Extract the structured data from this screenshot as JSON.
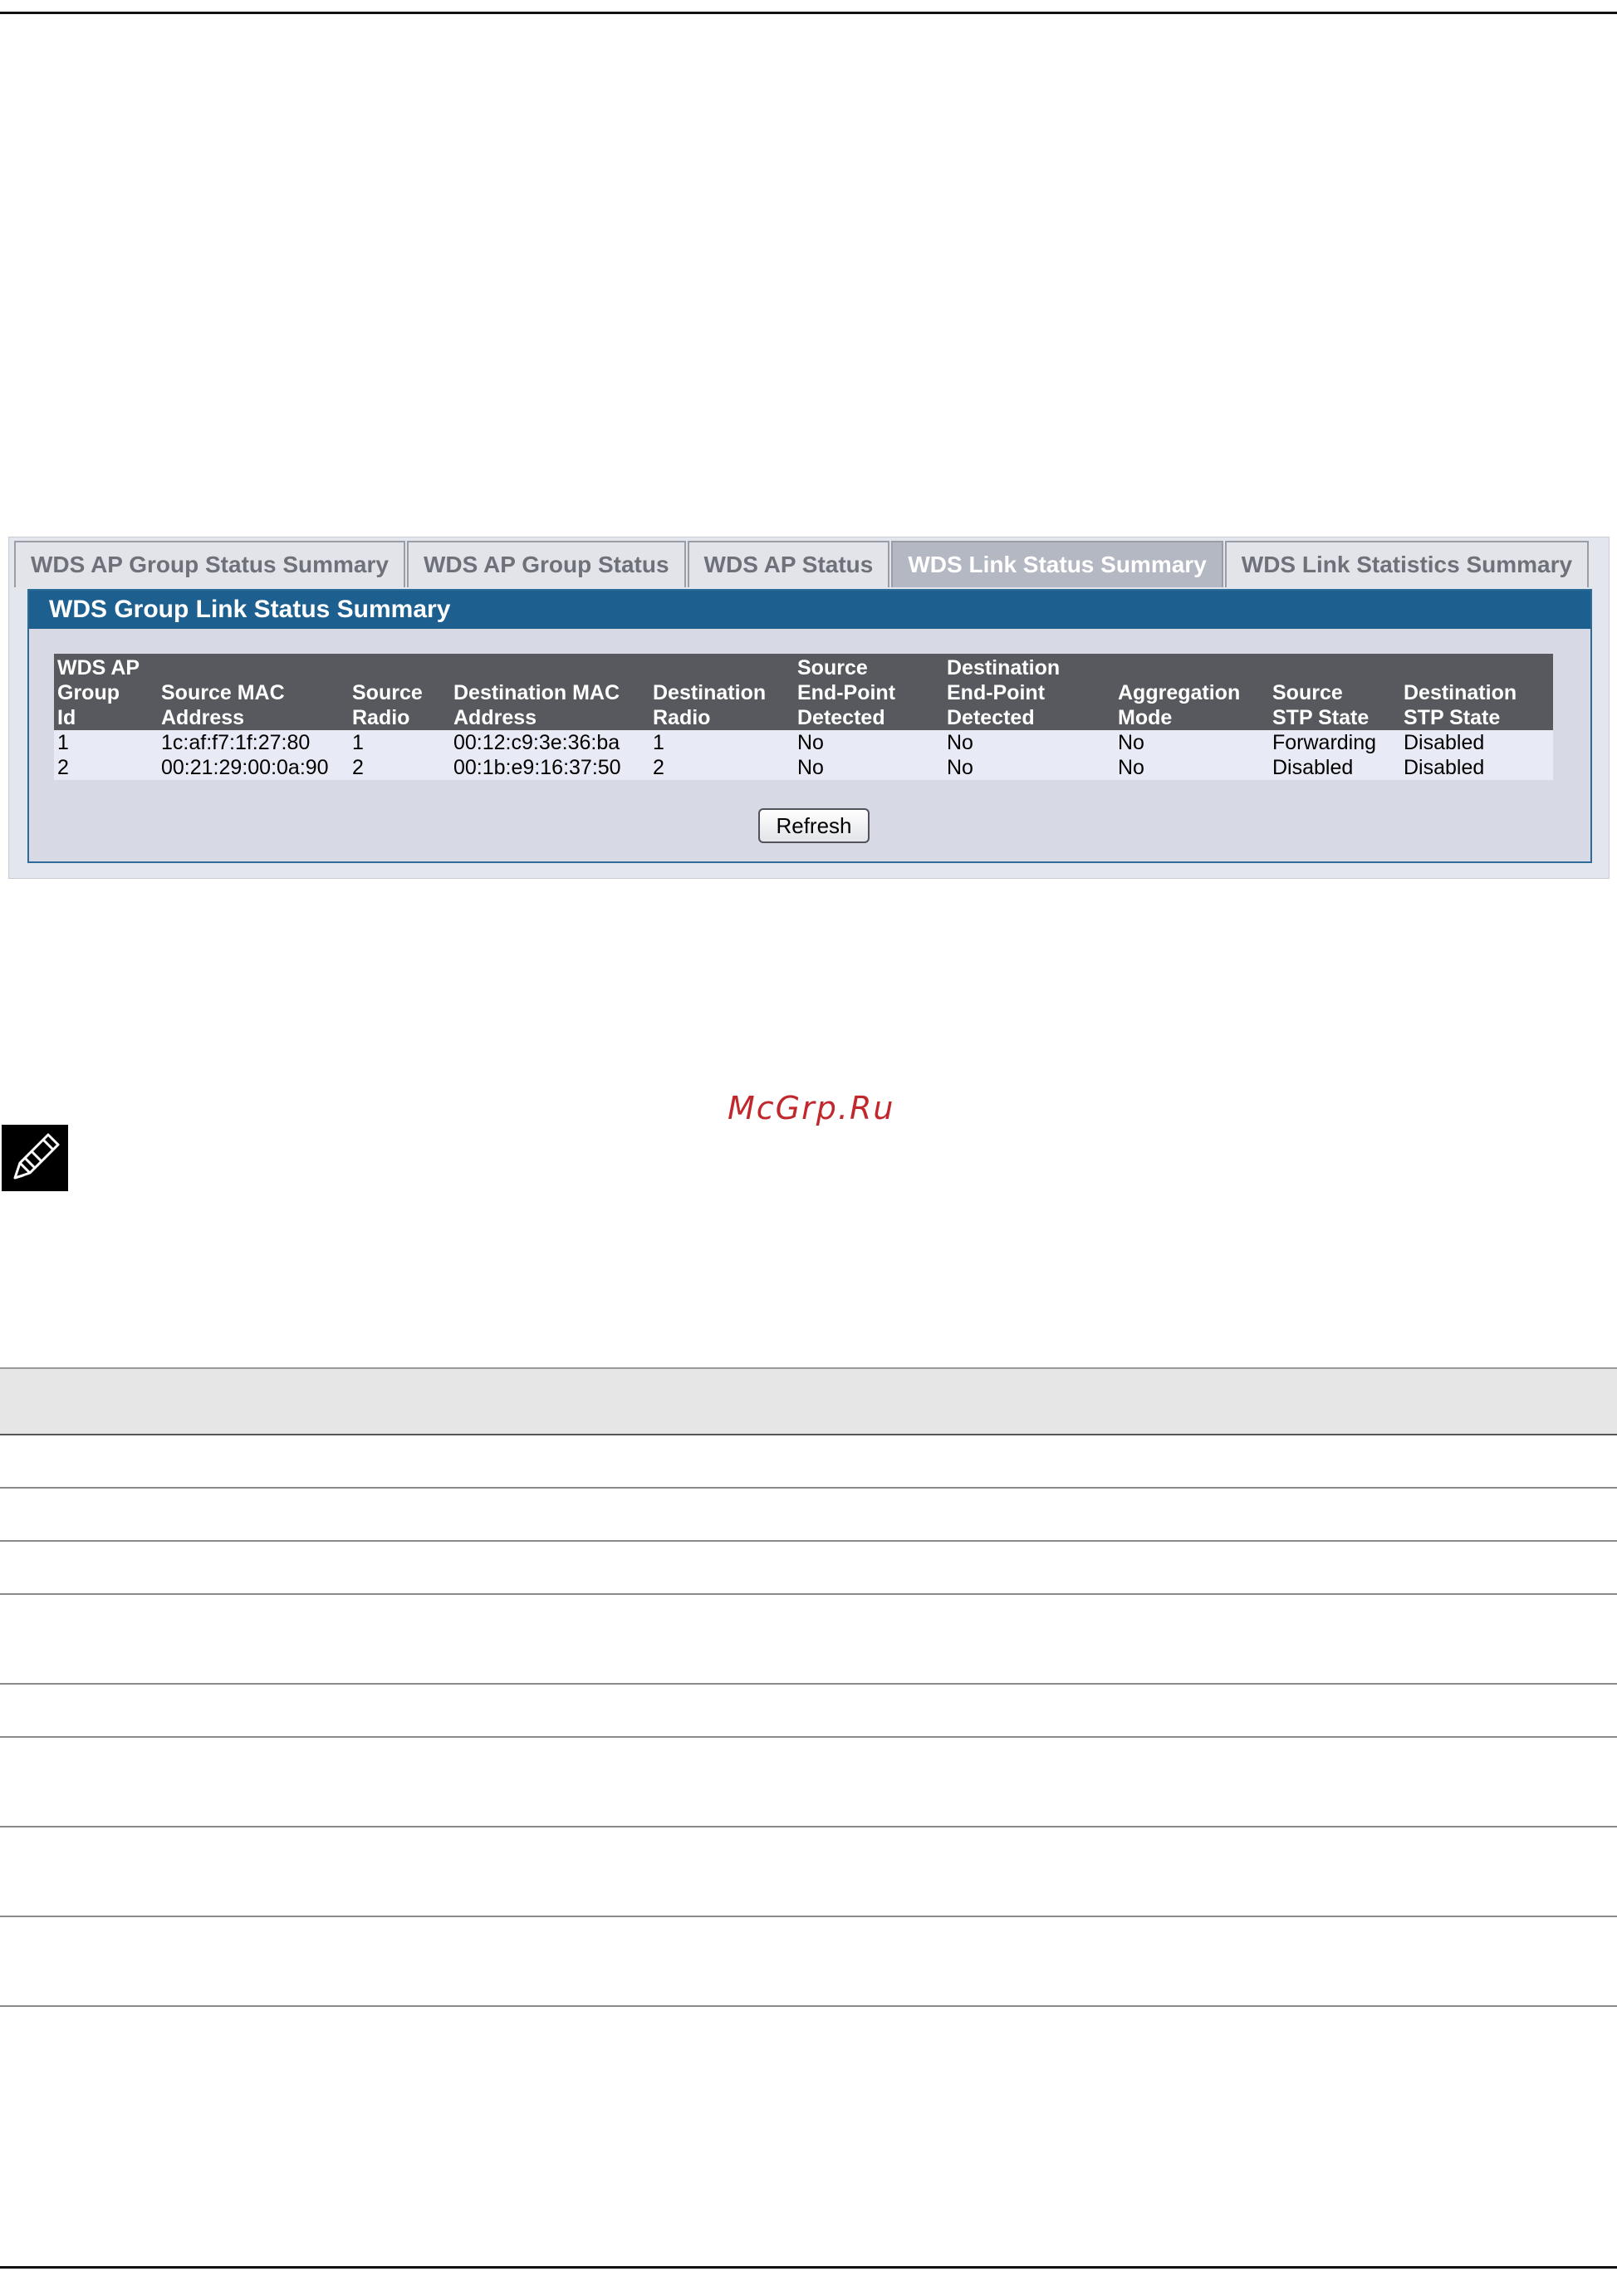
{
  "tabs": [
    {
      "label": "WDS AP Group Status Summary",
      "active": false
    },
    {
      "label": "WDS AP Group Status",
      "active": false
    },
    {
      "label": "WDS AP Status",
      "active": false
    },
    {
      "label": "WDS Link Status Summary",
      "active": true
    },
    {
      "label": "WDS Link Statistics Summary",
      "active": false
    }
  ],
  "panel": {
    "title": "WDS Group Link Status Summary",
    "columns": [
      [
        "WDS AP",
        "Group",
        "Id"
      ],
      [
        "Source MAC",
        "Address"
      ],
      [
        "Source",
        "Radio"
      ],
      [
        "Destination MAC",
        "Address"
      ],
      [
        "Destination",
        "Radio"
      ],
      [
        "Source",
        "End-Point",
        "Detected"
      ],
      [
        "Destination",
        "End-Point",
        "Detected"
      ],
      [
        "Aggregation",
        "Mode"
      ],
      [
        "Source",
        "STP State"
      ],
      [
        "Destination",
        "STP State"
      ]
    ],
    "rows": [
      [
        "1",
        "1c:af:f7:1f:27:80",
        "1",
        "00:12:c9:3e:36:ba",
        "1",
        "No",
        "No",
        "No",
        "Forwarding",
        "Disabled"
      ],
      [
        "2",
        "00:21:29:00:0a:90",
        "2",
        "00:1b:e9:16:37:50",
        "2",
        "No",
        "No",
        "No",
        "Disabled",
        "Disabled"
      ]
    ],
    "refresh_label": "Refresh"
  },
  "watermark": "McGrp.Ru",
  "icons": {
    "note": "pencil-note-icon"
  }
}
